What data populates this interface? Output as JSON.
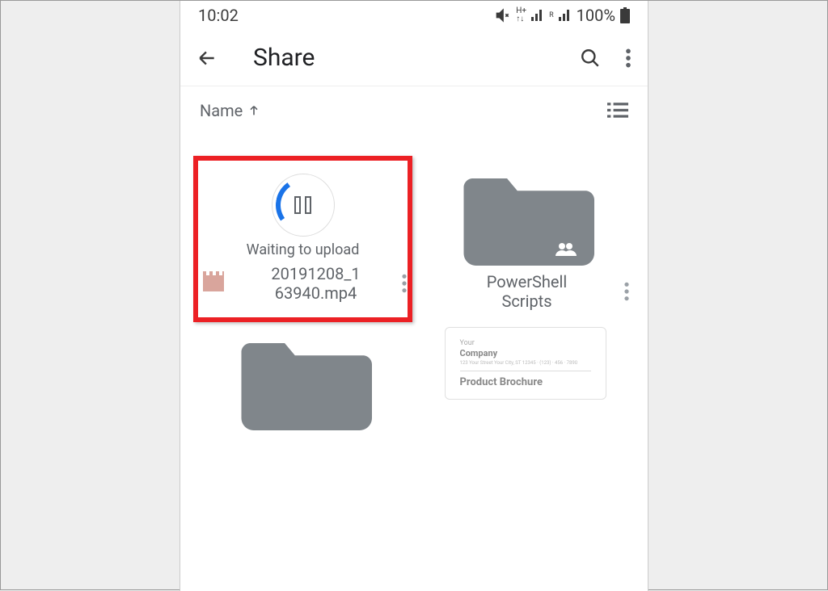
{
  "status": {
    "time": "10:02",
    "battery_pct": "100%"
  },
  "appbar": {
    "title": "Share"
  },
  "sort": {
    "label": "Name"
  },
  "items": [
    {
      "upload_status": "Waiting to upload",
      "filename_l1": "20191208_1",
      "filename_l2": "63940.mp4"
    },
    {
      "name_l1": "PowerShell",
      "name_l2": "Scripts"
    }
  ],
  "doc": {
    "l1": "Your",
    "l2": "Company",
    "l3": "Product Brochure"
  }
}
